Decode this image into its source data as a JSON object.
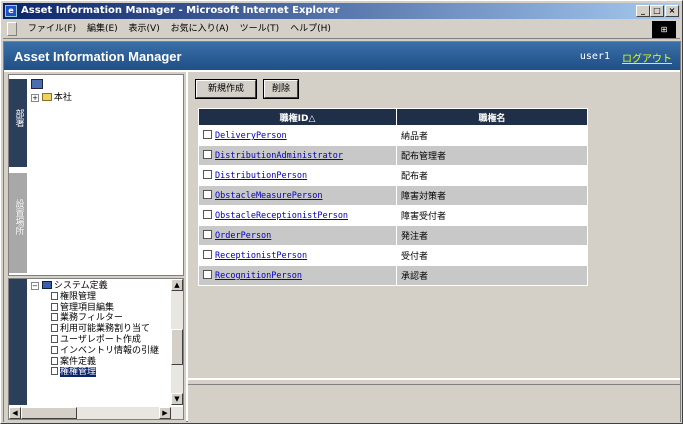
{
  "window": {
    "title": "Asset Information Manager - Microsoft Internet Explorer",
    "minimize": "_",
    "maximize": "□",
    "close": "×"
  },
  "menu": {
    "items": [
      "ファイル(F)",
      "編集(E)",
      "表示(V)",
      "お気に入り(A)",
      "ツール(T)",
      "ヘルプ(H)"
    ]
  },
  "banner": {
    "app_title": "Asset Information Manager",
    "user": "user1",
    "logout": "ログアウト"
  },
  "left": {
    "tab_dept": "部署",
    "tab_location": "設置場所",
    "tree_top": {
      "root": "本社"
    },
    "tree_bottom": {
      "parent": "システム定義",
      "items": [
        "権限管理",
        "管理項目編集",
        "業務フィルター",
        "利用可能業務割り当て",
        "ユーザレポート作成",
        "インベントリ情報の引継",
        "案件定義",
        "権権管理"
      ],
      "selected_index": 7
    }
  },
  "toolbar": {
    "new_label": "新規作成",
    "delete_label": "削除"
  },
  "table": {
    "headers": [
      "職権ID△",
      "職権名"
    ],
    "rows": [
      {
        "id": "DeliveryPerson",
        "name": "納品者"
      },
      {
        "id": "DistributionAdministrator",
        "name": "配布管理者"
      },
      {
        "id": "DistributionPerson",
        "name": "配布者"
      },
      {
        "id": "ObstacleMeasurePerson",
        "name": "障害対策者"
      },
      {
        "id": "ObstacleReceptionistPerson",
        "name": "障害受付者"
      },
      {
        "id": "OrderPerson",
        "name": "発注者"
      },
      {
        "id": "ReceptionistPerson",
        "name": "受付者"
      },
      {
        "id": "RecognitionPerson",
        "name": "承認者"
      }
    ]
  },
  "colors": {
    "header_bg": "#1f2f47",
    "banner_bg": "#2a5b93",
    "link": "#0000c0",
    "logout": "#e8ff00"
  }
}
